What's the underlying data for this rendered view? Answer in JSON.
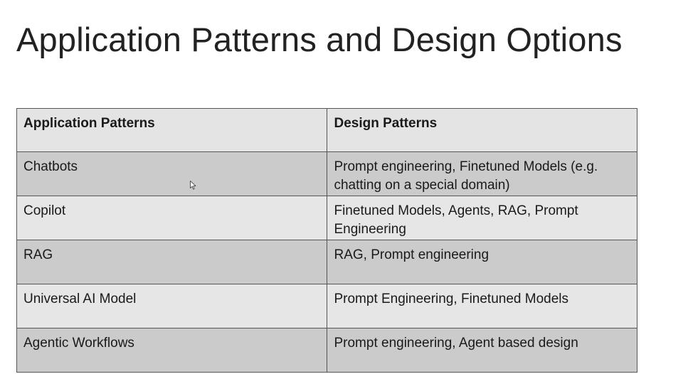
{
  "slide": {
    "title": "Application Patterns and Design Options"
  },
  "table": {
    "headers": {
      "application": "Application Patterns",
      "design": "Design Patterns"
    },
    "rows": [
      {
        "application": "Chatbots",
        "design": "Prompt engineering, Finetuned Models (e.g. chatting on a special domain)"
      },
      {
        "application": "Copilot",
        "design": "Finetuned Models, Agents, RAG, Prompt Engineering"
      },
      {
        "application": "RAG",
        "design": "RAG, Prompt engineering"
      },
      {
        "application": "Universal AI Model",
        "design": "Prompt Engineering, Finetuned Models"
      },
      {
        "application": "Agentic Workflows",
        "design": "Prompt engineering, Agent based design"
      }
    ]
  },
  "colors": {
    "header_bg": "#e4e4e4",
    "row_dark_bg": "#cbcbcb",
    "row_light_bg": "#e6e6e6",
    "border": "#555555",
    "text": "#1a1a1a"
  }
}
